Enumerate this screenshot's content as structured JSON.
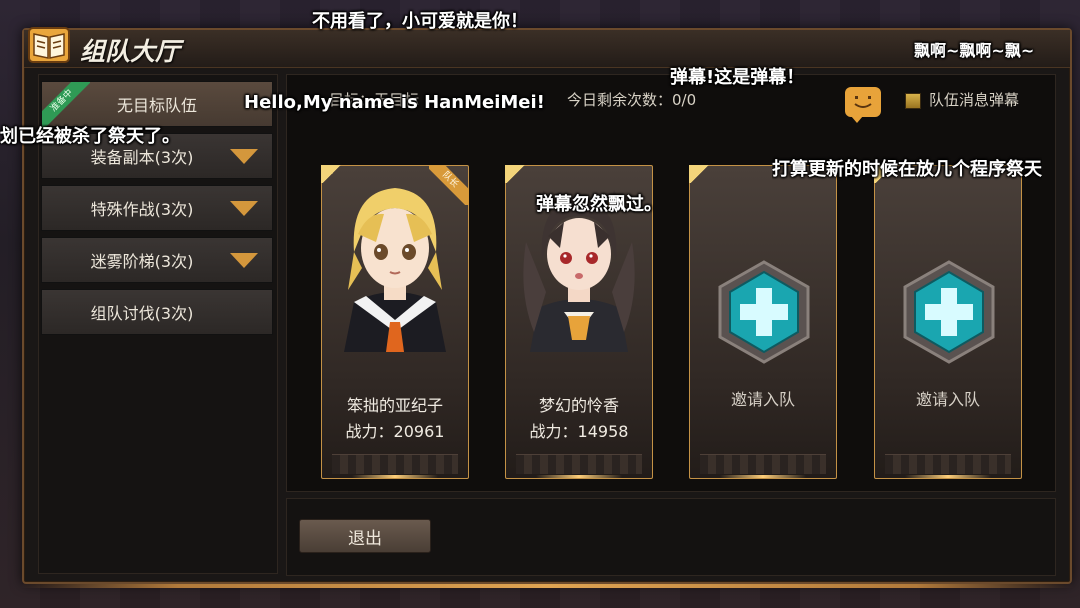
{
  "window": {
    "title": "组队大厅"
  },
  "nav": {
    "items": [
      {
        "label": "无目标队伍",
        "active": true,
        "ribbon": "准备中"
      },
      {
        "label": "装备副本(3次)",
        "has_arrow": true
      },
      {
        "label": "特殊作战(3次)",
        "has_arrow": true
      },
      {
        "label": "迷雾阶梯(3次)",
        "has_arrow": true
      },
      {
        "label": "组队讨伐(3次)"
      }
    ]
  },
  "main": {
    "target_label": "目标：无目标",
    "remaining_label": "今日剩余次数：0/0",
    "danmaku_toggle_label": "队伍消息弹幕",
    "chat_icon": "chat-bubble-smile-icon"
  },
  "cards": [
    {
      "name": "笨拙的亚纪子",
      "power": "战力：20961",
      "leader_badge": "队长",
      "portrait": "blonde-girl-portrait"
    },
    {
      "name": "梦幻的怜香",
      "power": "战力：14958",
      "portrait": "dark-hair-girl-portrait"
    },
    {
      "invite": "邀请入队",
      "icon": "plus-hex-icon"
    },
    {
      "invite": "邀请入队",
      "icon": "plus-hex-icon"
    }
  ],
  "bottom": {
    "exit_label": "退出"
  },
  "danmaku": [
    "不用看了，小可爱就是你！",
    "飘啊~飘啊~飘~",
    "弹幕!这是弹幕！",
    "Hello,My name is HanMeiMei!",
    "划已经被杀了祭天了。",
    "打算更新的时候在放几个程序祭天",
    "弹幕忽然飘过。"
  ],
  "colors": {
    "accent_gold": "#c49246",
    "chat_orange": "#e8a33a",
    "ribbon_green": "#2f9a55",
    "plus_teal": "#1aa6b0"
  }
}
